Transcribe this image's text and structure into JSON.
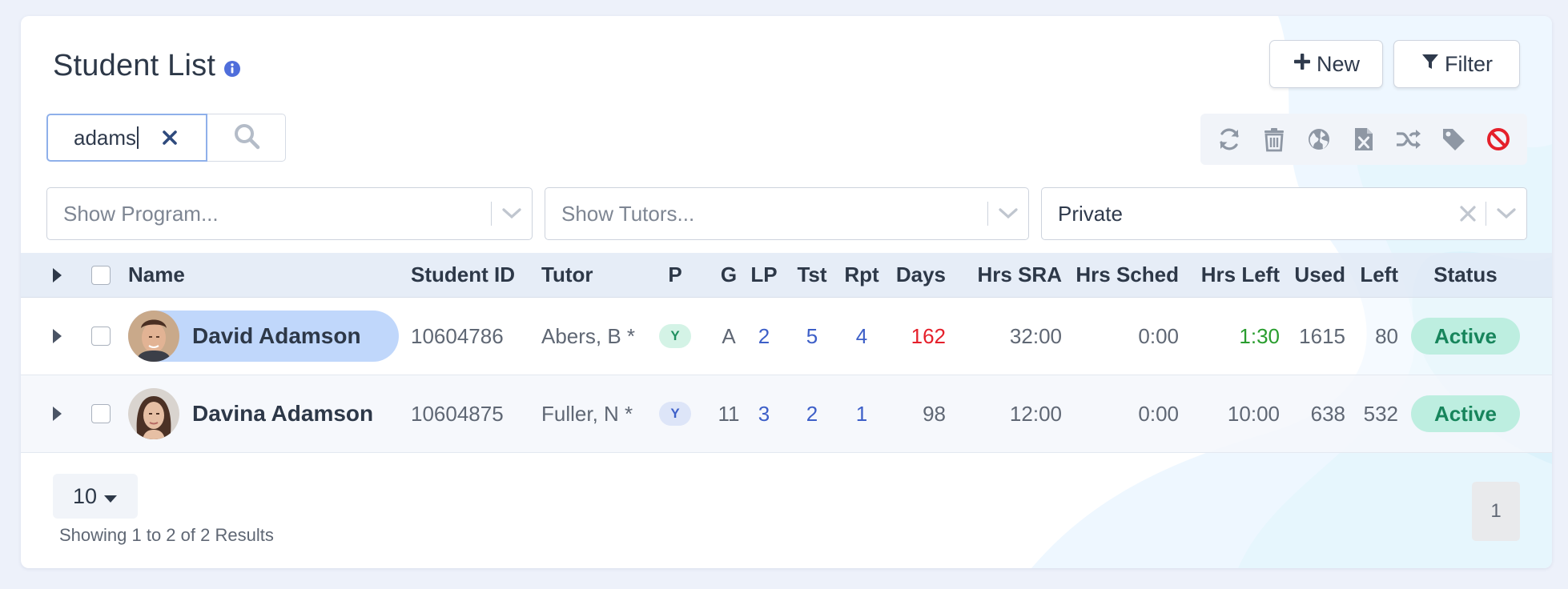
{
  "header": {
    "title": "Student List",
    "new_label": "New",
    "filter_label": "Filter"
  },
  "search": {
    "value": "adams",
    "icons": [
      "clear-icon",
      "search-icon"
    ]
  },
  "toolbar": {
    "icons": [
      "refresh-icon",
      "trash-icon",
      "globe-icon",
      "excel-file-icon",
      "shuffle-icon",
      "tag-icon",
      "ban-icon"
    ]
  },
  "filters": {
    "program_placeholder": "Show Program...",
    "tutors_placeholder": "Show Tutors...",
    "type_value": "Private"
  },
  "table": {
    "columns": {
      "name": "Name",
      "student_id": "Student ID",
      "tutor": "Tutor",
      "p": "P",
      "g": "G",
      "lp": "LP",
      "tst": "Tst",
      "rpt": "Rpt",
      "days": "Days",
      "hrs_sra": "Hrs SRA",
      "hrs_sched": "Hrs Sched",
      "hrs_left": "Hrs Left",
      "used": "Used",
      "left": "Left",
      "status": "Status"
    },
    "rows": [
      {
        "name": "David Adamson",
        "student_id": "10604786",
        "tutor": "Abers, B *",
        "p": "Y",
        "g": "A",
        "lp": "2",
        "tst": "5",
        "rpt": "4",
        "days": "162",
        "hrs_sra": "32:00",
        "hrs_sched": "0:00",
        "hrs_left": "1:30",
        "used": "1615",
        "left": "80",
        "status": "Active"
      },
      {
        "name": "Davina Adamson",
        "student_id": "10604875",
        "tutor": "Fuller, N *",
        "p": "Y",
        "g": "11",
        "lp": "3",
        "tst": "2",
        "rpt": "1",
        "days": "98",
        "hrs_sra": "12:00",
        "hrs_sched": "0:00",
        "hrs_left": "10:00",
        "used": "638",
        "left": "532",
        "status": "Active"
      }
    ]
  },
  "pagination": {
    "page_size": "10",
    "summary": "Showing 1 to 2 of 2 Results",
    "current_page": "1"
  },
  "colors": {
    "accent": "#3d5fc8",
    "status_active_bg": "#bdeee0",
    "status_active_text": "#17855c",
    "selected_row_chip": "#c0d7fb",
    "danger": "#e5202b"
  }
}
